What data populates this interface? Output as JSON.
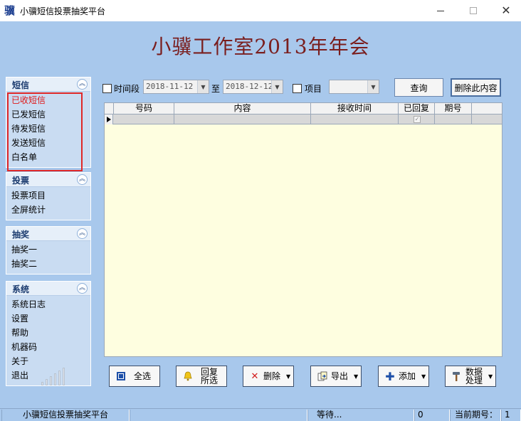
{
  "window": {
    "icon_glyph": "骥",
    "title": "小骥短信投票抽奖平台",
    "close_glyph": "✕"
  },
  "banner": "小骥工作室2013年年会",
  "sidebar": {
    "collapse_glyph": "︽",
    "panels": [
      {
        "title": "短信",
        "items": [
          "已收短信",
          "已发短信",
          "待发短信",
          "发送短信",
          "白名单"
        ],
        "active_index": 0
      },
      {
        "title": "投票",
        "items": [
          "投票项目",
          "全屏统计"
        ]
      },
      {
        "title": "抽奖",
        "items": [
          "抽奖一",
          "抽奖二"
        ]
      },
      {
        "title": "系统",
        "items": [
          "系统日志",
          "设置",
          "帮助",
          "机器码",
          "关于",
          "退出"
        ]
      }
    ],
    "active_color": "#e01818"
  },
  "filters": {
    "period_label": "时间段",
    "date_from": "2018-11-12",
    "to_label": "至",
    "date_to": "2018-12-12",
    "item_label": "项目",
    "item_value": "",
    "query_button": "查询",
    "delete_content_button": "删除此内容"
  },
  "grid": {
    "columns": [
      "号码",
      "内容",
      "接收时间",
      "已回复",
      "期号"
    ],
    "rows": [
      {
        "number": "",
        "content": "",
        "received": "",
        "replied": true,
        "issue": ""
      }
    ],
    "check_glyph": "✓"
  },
  "toolbar": {
    "select_all": "全选",
    "reply_selected_line1": "回复",
    "reply_selected_line2": "所选",
    "delete": "删除",
    "export": "导出",
    "add": "添加",
    "data_process_line1": "数据",
    "data_process_line2": "处理"
  },
  "statusbar": {
    "app_name": "小骥短信投票抽奖平台",
    "blank": "",
    "status": "等待...",
    "count": "0",
    "current_issue_label": "当前期号：",
    "current_issue_value": "1"
  },
  "colors": {
    "background": "#a8c8ec",
    "banner": "#7a1e1e",
    "grid_bg": "#fefee0",
    "highlight": "#e02828"
  }
}
